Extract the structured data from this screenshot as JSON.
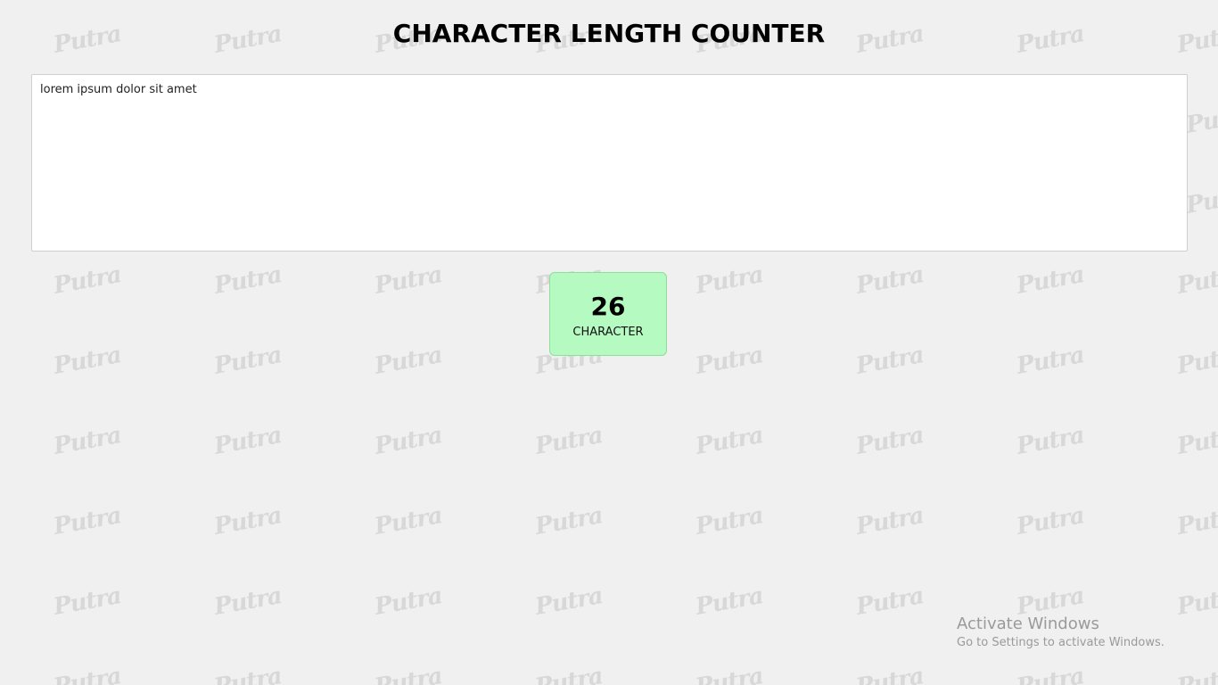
{
  "header": {
    "title": "CHARACTER LENGTH COUNTER"
  },
  "input": {
    "value": "lorem ipsum dolor sit amet"
  },
  "counter": {
    "value": "26",
    "label": "CHARACTER",
    "background_color": "#b5fbc1"
  },
  "watermark": {
    "text": "Putra"
  },
  "os_overlay": {
    "title": "Activate Windows",
    "subtitle": "Go to Settings to activate Windows."
  }
}
